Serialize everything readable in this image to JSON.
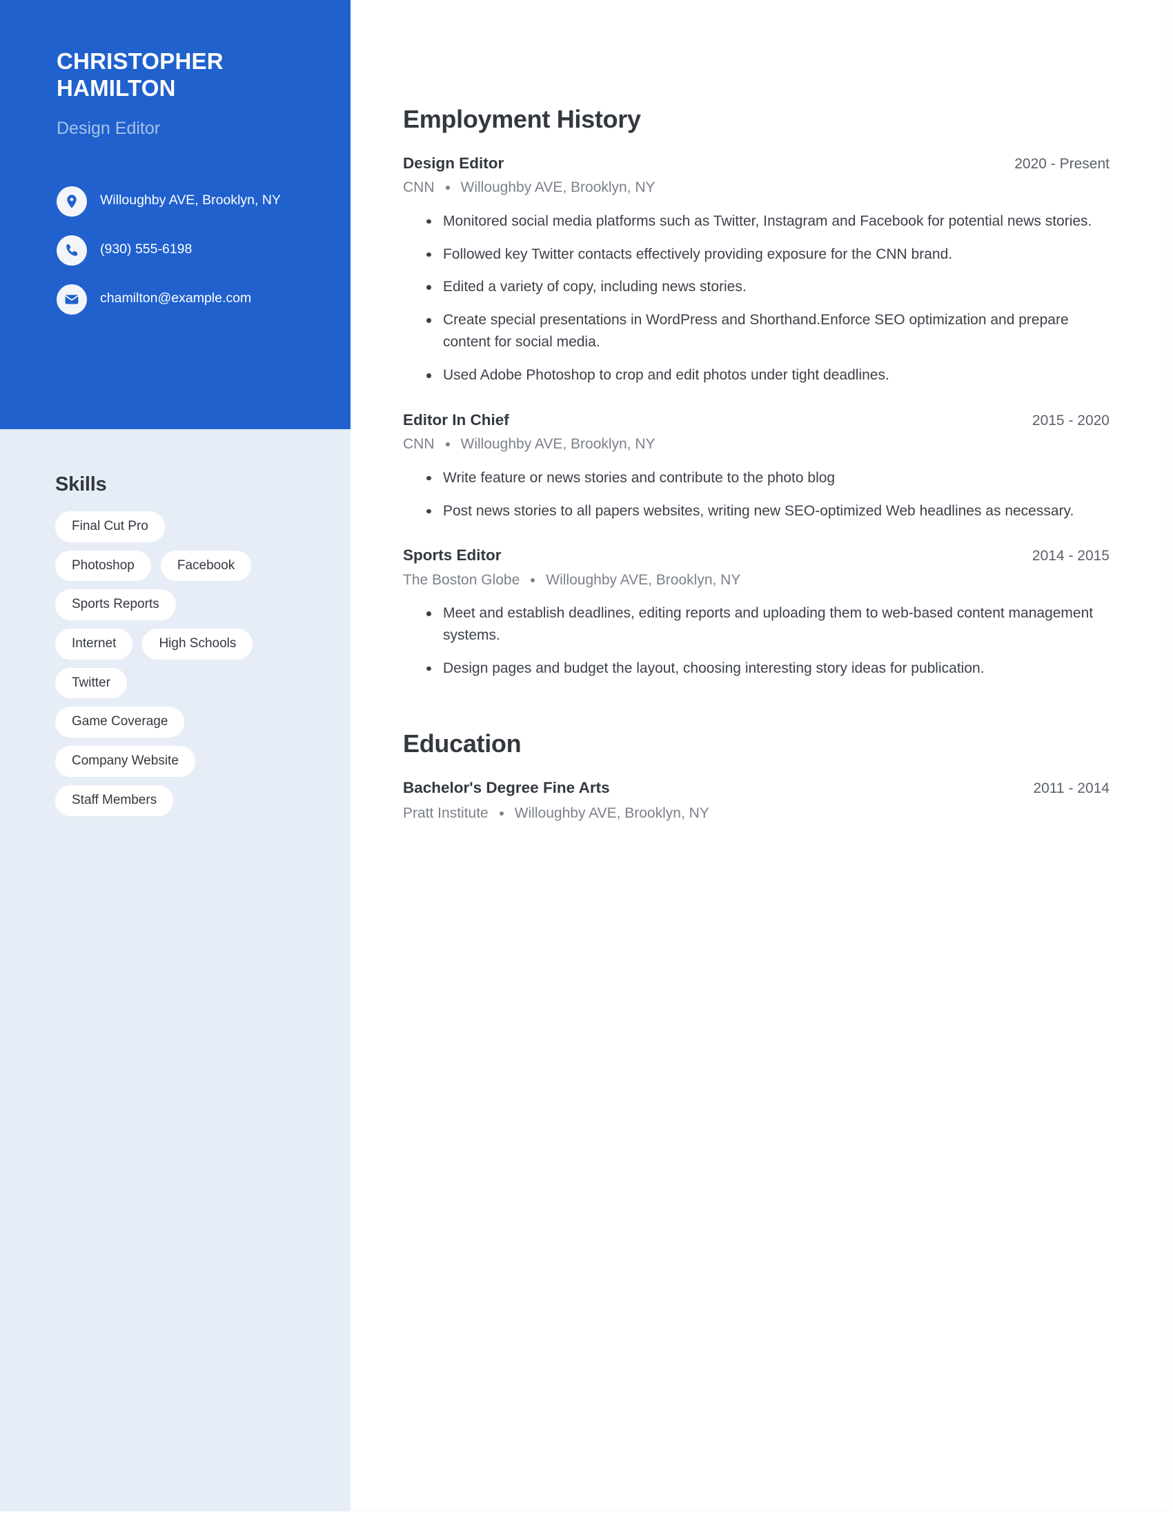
{
  "theme": {
    "accent_blue": "#2061CE",
    "sidebar_bg": "#E7EDF7",
    "pill_bg": "#FFFFFF",
    "heading_color": "#33383F",
    "muted_text": "#7C818A",
    "subtitle_blue": "#A8C2EA"
  },
  "profile": {
    "name": "CHRISTOPHER HAMILTON",
    "title": "Design Editor",
    "contacts": [
      {
        "icon": "location-pin-icon",
        "text": "Willoughby AVE, Brooklyn, NY"
      },
      {
        "icon": "phone-icon",
        "text": "(930) 555-6198"
      },
      {
        "icon": "envelope-icon",
        "text": "chamilton@example.com"
      }
    ]
  },
  "skills": {
    "title": "Skills",
    "rows": [
      [
        "Final Cut Pro"
      ],
      [
        "Photoshop",
        "Facebook"
      ],
      [
        "Sports Reports"
      ],
      [
        "Internet",
        "High Schools"
      ],
      [
        "Twitter"
      ],
      [
        "Game Coverage"
      ],
      [
        "Company Website"
      ],
      [
        "Staff Members"
      ]
    ],
    "items": [
      "Final Cut Pro",
      "Photoshop",
      "Facebook",
      "Sports Reports",
      "Internet",
      "High Schools",
      "Twitter",
      "Game Coverage",
      "Company Website",
      "Staff Members"
    ]
  },
  "employment": {
    "title": "Employment History",
    "entries": [
      {
        "role": "Design Editor",
        "dates": "2020 - Present",
        "company": "CNN",
        "location": "Willoughby AVE, Brooklyn, NY",
        "bullets": [
          "Monitored social media platforms such as Twitter, Instagram and Facebook for potential news stories.",
          "Followed key Twitter contacts effectively providing exposure for the CNN brand.",
          "Edited a variety of copy, including news stories.",
          "Create special presentations in WordPress and Shorthand.Enforce SEO optimization and prepare content for social media.",
          "Used Adobe Photoshop to crop and edit photos under tight deadlines."
        ]
      },
      {
        "role": "Editor In Chief",
        "dates": "2015 - 2020",
        "company": "CNN",
        "location": "Willoughby AVE, Brooklyn, NY",
        "bullets": [
          "Write feature or news stories and contribute to the photo blog",
          "Post news stories to all papers websites, writing new SEO-optimized Web headlines as necessary."
        ]
      },
      {
        "role": "Sports Editor",
        "dates": "2014 - 2015",
        "company": "The Boston Globe",
        "location": "Willoughby AVE, Brooklyn, NY",
        "bullets": [
          "Meet and establish deadlines, editing reports and uploading them to web-based content management systems.",
          "Design pages and budget the layout, choosing interesting story ideas for publication."
        ]
      }
    ]
  },
  "education": {
    "title": "Education",
    "entries": [
      {
        "degree": "Bachelor's Degree Fine Arts",
        "dates": "2011 - 2014",
        "school": "Pratt Institute",
        "location": "Willoughby AVE, Brooklyn, NY"
      }
    ]
  }
}
